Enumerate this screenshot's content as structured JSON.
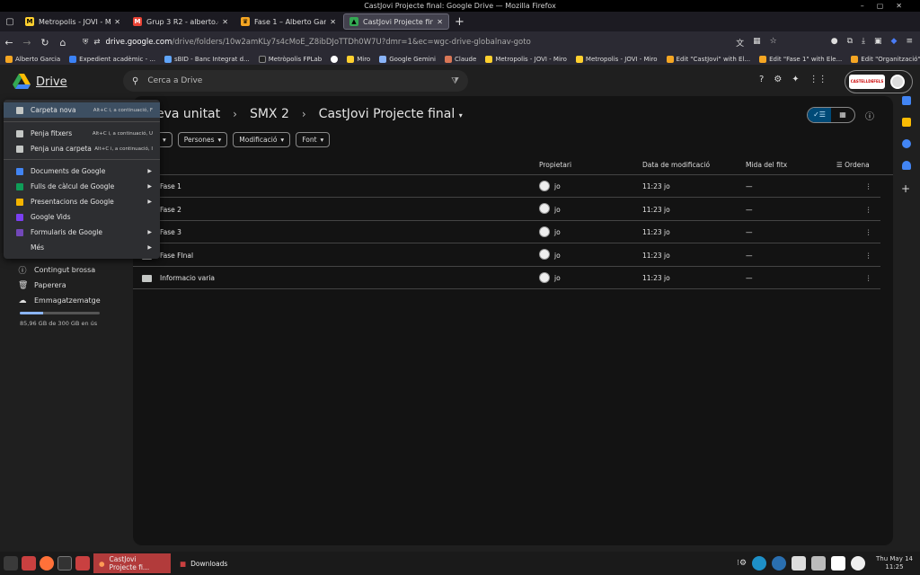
{
  "window": {
    "title": "CastJovi Projecte final: Google Drive — Mozilla Firefox"
  },
  "tabs": [
    {
      "label": "Metropolis - JOVI - Miro",
      "icon": "miro-icon",
      "color": "#ffd02f"
    },
    {
      "label": "Grup 3 R2 - alberto.garcia@",
      "icon": "gmail-icon",
      "color": "#ea4335"
    },
    {
      "label": "Fase 1 – Alberto Garcia",
      "icon": "chrome-dino-icon",
      "color": "#f5a623"
    },
    {
      "label": "CastJovi Projecte final: Goo",
      "icon": "drive-icon",
      "color": "#34a853",
      "active": true
    }
  ],
  "address": {
    "host": "drive.google.com",
    "path": "/drive/folders/10w2amKLy7s4cMoE_Z8ibDJoTTDh0W7U?dmr=1&ec=wgc-drive-globalnav-goto"
  },
  "bookmarks": [
    {
      "label": "Alberto Garcia",
      "color": "#f5a623"
    },
    {
      "label": "Expedient acadèmic - ...",
      "color": "#3b82f6"
    },
    {
      "label": "sBID - Banc Integrat d...",
      "color": "#60a5fa"
    },
    {
      "label": "Metròpolis FPLab",
      "color": "#222222"
    },
    {
      "label": "",
      "color": "#ffffff"
    },
    {
      "label": "Miro",
      "color": "#ffd02f"
    },
    {
      "label": "Google Gemini",
      "color": "#8ab4f8"
    },
    {
      "label": "Claude",
      "color": "#d97757"
    },
    {
      "label": "Metropolis - JOVI - Miro",
      "color": "#ffd02f"
    },
    {
      "label": "Metropolis - JOVI - Miro",
      "color": "#ffd02f"
    },
    {
      "label": "Edit \"CastJovi\" with El...",
      "color": "#f5a623"
    },
    {
      "label": "Edit \"Fase 1\" with Ele...",
      "color": "#f5a623"
    },
    {
      "label": "Edit \"Organització\" wi...",
      "color": "#f5a623"
    }
  ],
  "drive": {
    "app_name": "Drive",
    "search_placeholder": "Cerca a Drive",
    "org_logo_text": "CASTELLDEFELS",
    "breadcrumb": [
      "eva unitat",
      "SMX 2",
      "CastJovi Projecte final"
    ],
    "filters": [
      "Persones",
      "Modificació",
      "Font"
    ],
    "columns": {
      "owner": "Propietari",
      "modified": "Data de modificació",
      "size": "Mida del fitx",
      "sort": "Ordena"
    },
    "rows": [
      {
        "name": "Fase 1",
        "owner": "jo",
        "modified": "11:23 jo",
        "size": "—"
      },
      {
        "name": "Fase 2",
        "owner": "jo",
        "modified": "11:23 jo",
        "size": "—"
      },
      {
        "name": "Fase 3",
        "owner": "jo",
        "modified": "11:23 jo",
        "size": "—"
      },
      {
        "name": "Fase FInal",
        "owner": "jo",
        "modified": "11:23 jo",
        "size": "—"
      },
      {
        "name": "Informacio varia",
        "owner": "jo",
        "modified": "11:23 jo",
        "size": "—"
      }
    ],
    "sidebar": {
      "spam": "Contingut brossa",
      "trash": "Paperera",
      "storage": "Emmagatzematge",
      "storage_text": "85,96 GB de 300 GB en ús",
      "storage_fraction": 0.287
    }
  },
  "new_menu": {
    "items": [
      {
        "label": "Carpeta nova",
        "shortcut": "Alt+C i, a continuació, F",
        "icon": "new-folder-icon",
        "color": "#c4c7c5"
      },
      {
        "label": "Penja fitxers",
        "shortcut": "Alt+C i, a continuació, U",
        "icon": "upload-file-icon",
        "color": "#c4c7c5"
      },
      {
        "label": "Penja una carpeta",
        "shortcut": "Alt+C i, a continuació, I",
        "icon": "upload-folder-icon",
        "color": "#c4c7c5"
      },
      {
        "label": "Documents de Google",
        "icon": "docs-icon",
        "color": "#4285f4",
        "submenu": true
      },
      {
        "label": "Fulls de càlcul de Google",
        "icon": "sheets-icon",
        "color": "#0f9d58",
        "submenu": true
      },
      {
        "label": "Presentacions de Google",
        "icon": "slides-icon",
        "color": "#f4b400",
        "submenu": true
      },
      {
        "label": "Google Vids",
        "icon": "vids-icon",
        "color": "#7b3ff2"
      },
      {
        "label": "Formularis de Google",
        "icon": "forms-icon",
        "color": "#7248b9",
        "submenu": true
      },
      {
        "label": "Més",
        "icon": "",
        "color": "transparent",
        "submenu": true
      }
    ]
  },
  "taskbar": {
    "active_window": "CastJovi Projecte fi...",
    "folder_window": "Downloads",
    "clock_day": "Thu May 14",
    "clock_time": "11:25"
  }
}
